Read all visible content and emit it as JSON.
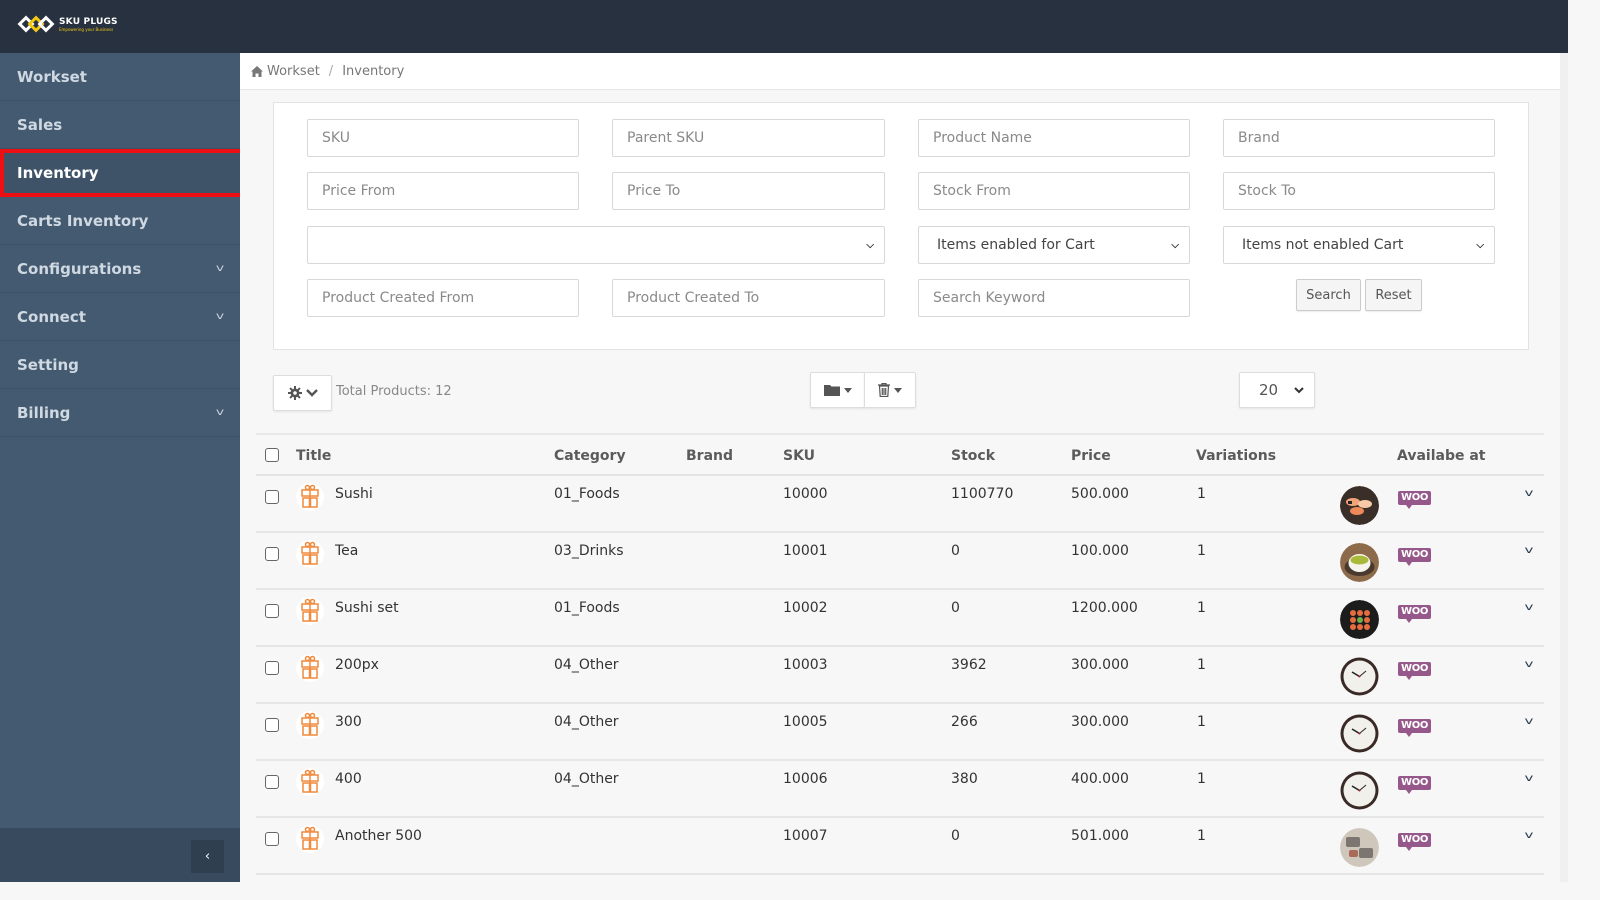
{
  "brand": {
    "name": "SKU PLUGS",
    "tagline": "Empowering your Business"
  },
  "sidebar": {
    "items": [
      {
        "label": "Workset",
        "has_chevron": false,
        "active": false
      },
      {
        "label": "Sales",
        "has_chevron": false,
        "active": false
      },
      {
        "label": "Inventory",
        "has_chevron": false,
        "active": true
      },
      {
        "label": "Carts Inventory",
        "has_chevron": false,
        "active": false
      },
      {
        "label": "Configurations",
        "has_chevron": true,
        "active": false
      },
      {
        "label": "Connect",
        "has_chevron": true,
        "active": false
      },
      {
        "label": "Setting",
        "has_chevron": false,
        "active": false
      },
      {
        "label": "Billing",
        "has_chevron": true,
        "active": false
      }
    ],
    "chevron_glyph": "v",
    "collapse_glyph": "‹",
    "highlight_color": "#ee0f14"
  },
  "breadcrumb": {
    "home": "Workset",
    "separator": "/",
    "current": "Inventory"
  },
  "filters": {
    "sku": {
      "placeholder": "SKU",
      "value": ""
    },
    "parent_sku": {
      "placeholder": "Parent SKU",
      "value": ""
    },
    "product_name": {
      "placeholder": "Product Name",
      "value": ""
    },
    "brand": {
      "placeholder": "Brand",
      "value": ""
    },
    "price_from": {
      "placeholder": "Price From",
      "value": ""
    },
    "price_to": {
      "placeholder": "Price To",
      "value": ""
    },
    "stock_from": {
      "placeholder": "Stock From",
      "value": ""
    },
    "stock_to": {
      "placeholder": "Stock To",
      "value": ""
    },
    "category_select": {
      "selected": ""
    },
    "cart_enabled_select": {
      "selected": "Items enabled for Cart"
    },
    "cart_not_enabled_select": {
      "selected": "Items not enabled Cart"
    },
    "created_from": {
      "placeholder": "Product Created From",
      "value": ""
    },
    "created_to": {
      "placeholder": "Product Created To",
      "value": ""
    },
    "keyword": {
      "placeholder": "Search Keyword",
      "value": ""
    },
    "search_label": "Search",
    "reset_label": "Reset"
  },
  "toolbar": {
    "total_products": "Total Products: 12",
    "page_size": "20"
  },
  "table": {
    "columns": [
      "Title",
      "Category",
      "Brand",
      "SKU",
      "Stock",
      "Price",
      "Variations",
      "Availabe at"
    ],
    "rows": [
      {
        "title": "Sushi",
        "category": "01_Foods",
        "brand": "",
        "sku": "10000",
        "stock": "1100770",
        "price": "500.000",
        "variations": "1",
        "image": "sushi",
        "channel": "WOO"
      },
      {
        "title": "Tea",
        "category": "03_Drinks",
        "brand": "",
        "sku": "10001",
        "stock": "0",
        "price": "100.000",
        "variations": "1",
        "image": "tea",
        "channel": "WOO"
      },
      {
        "title": "Sushi set",
        "category": "01_Foods",
        "brand": "",
        "sku": "10002",
        "stock": "0",
        "price": "1200.000",
        "variations": "1",
        "image": "sushi-set",
        "channel": "WOO"
      },
      {
        "title": "200px",
        "category": "04_Other",
        "brand": "",
        "sku": "10003",
        "stock": "3962",
        "price": "300.000",
        "variations": "1",
        "image": "clock",
        "channel": "WOO"
      },
      {
        "title": "300",
        "category": "04_Other",
        "brand": "",
        "sku": "10005",
        "stock": "266",
        "price": "300.000",
        "variations": "1",
        "image": "clock",
        "channel": "WOO"
      },
      {
        "title": "400",
        "category": "04_Other",
        "brand": "",
        "sku": "10006",
        "stock": "380",
        "price": "400.000",
        "variations": "1",
        "image": "clock",
        "channel": "WOO"
      },
      {
        "title": "Another 500",
        "category": "",
        "brand": "",
        "sku": "10007",
        "stock": "0",
        "price": "501.000",
        "variations": "1",
        "image": "boxes",
        "channel": "WOO"
      }
    ]
  },
  "colors": {
    "topbar": "#27313f",
    "sidebar": "#435a70",
    "woo": "#96588a",
    "gift_icon": "#f08a3c"
  }
}
